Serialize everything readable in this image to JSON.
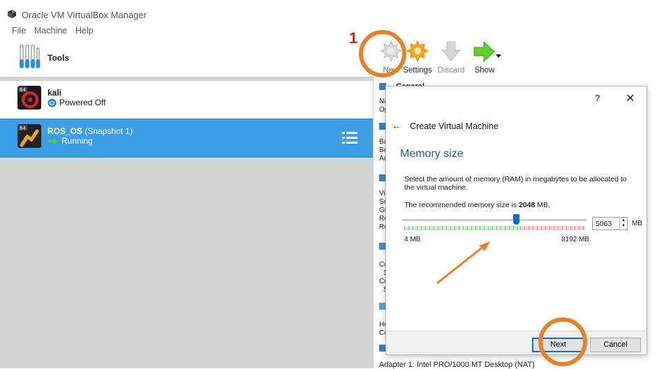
{
  "window": {
    "title": "Oracle VM VirtualBox Manager"
  },
  "menu": [
    "File",
    "Machine",
    "Help"
  ],
  "tools": {
    "label": "Tools"
  },
  "vms": [
    {
      "name": "kali",
      "snapshot": "",
      "status": "Powered Off",
      "selected": false
    },
    {
      "name": "ROS_OS",
      "snapshot": "(Snapshot 1)",
      "status": "Running",
      "selected": true
    }
  ],
  "toolbar": {
    "new": "New",
    "settings": "Settings",
    "discard": "Discard",
    "show": "Show"
  },
  "details": {
    "general": "General",
    "fragments": [
      "Na",
      "Op",
      "Ba",
      "Bo",
      "Ac",
      "Vi",
      "Sc",
      "Gr",
      "Re",
      "Re",
      "Co",
      "1",
      "Co",
      "S",
      "Ho",
      "Co"
    ],
    "adapter": "Adapter 1:  Intel PRO/1000 MT Desktop (NAT)"
  },
  "dialog": {
    "help": "?",
    "close": "✕",
    "title": "Create Virtual Machine",
    "heading": "Memory size",
    "description": "Select the amount of memory (RAM) in megabytes to be allocated to the virtual machine.",
    "recommended_prefix": "The recommended memory size is",
    "recommended_value": "2048",
    "recommended_suffix": "MB.",
    "memory_value": "5063",
    "memory_unit": "MB",
    "min_label": "4 MB",
    "max_label": "8192 MB",
    "slider_fraction": 0.618,
    "next_label": "Next",
    "cancel_label": "Cancel"
  },
  "annotation": {
    "step_number": "1",
    "color": "#e8822a"
  }
}
